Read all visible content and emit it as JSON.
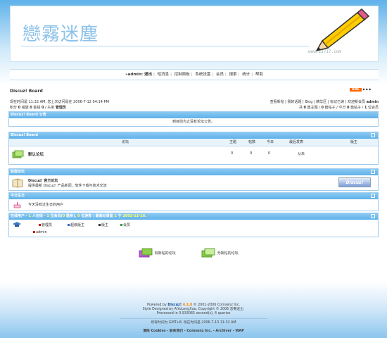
{
  "header": {
    "logo_text": "戀霧迷塵",
    "logo_url": "www.23717.com"
  },
  "menu": {
    "items": [
      "»admin: 退出",
      "短消息",
      "控制面板",
      "系统设置",
      "会员",
      "搜索",
      "统计",
      "帮助"
    ]
  },
  "breadcrumb": {
    "title": "Discuz! Board",
    "xml_label": "XML",
    "dots": "◆ ◆ ◆"
  },
  "info": {
    "left_line1": "现在时间是 11:32 AM, 您上次访问是在  2006-7-12 04:14 PM",
    "left_line2_prefix": "积分 ",
    "left_line2_a": "0",
    "left_line2_b": " 威望 ",
    "left_line2_c": "0",
    "left_line2_d": " 金钱 ",
    "left_line2_e": "0",
    "left_line2_f": " / 头衔 ",
    "left_line2_g": "管理员",
    "right_line1_a": "查看新帖 | 我的话题 | Blog | 精华区 | 标记已读 | 欢迎新会员 ",
    "right_line1_b": "admin",
    "right_line2_a": "共 ",
    "right_line2_b": "0",
    "right_line2_c": " 篇主题 / ",
    "right_line2_d": "0",
    "right_line2_e": " 篇帖子 / 今日 ",
    "right_line2_f": "0",
    "right_line2_g": " 篇帖子 / ",
    "right_line2_h": "1",
    "right_line2_i": " 位会员"
  },
  "announcement": {
    "title": "Discuz! Board 公告",
    "text": "到目前为止没有论坛公告。"
  },
  "forums": {
    "title": "Discuz! Board",
    "columns": [
      "论坛",
      "主题",
      "帖数",
      "今日",
      "最后发表",
      "版主"
    ],
    "rows": [
      {
        "name": "默认论坛",
        "topics": "0",
        "posts": "0",
        "today": "0",
        "last": "从未",
        "mod": ""
      }
    ]
  },
  "links": {
    "title": "联盟论坛",
    "name": "Discuz! 官方论坛",
    "desc": "提供最新 Discuz! 产品新闻、软件下载与技术交流",
    "button": "Discuz!"
  },
  "birthday": {
    "title": "今日生日",
    "text": "今天没有过生日的用户"
  },
  "online": {
    "title_a": "在线用户 - ",
    "title_b": "1",
    "title_c": " 人在线 - ",
    "title_d": "1",
    "title_e": " 位会员(",
    "title_f": "0",
    "title_g": " 隐身), ",
    "title_h": "0",
    "title_i": " 位游客 | 最高纪录是 ",
    "title_j": "1",
    "title_k": " 于 ",
    "title_l": "2002-12-16",
    "title_m": ".",
    "legend": [
      "管理员",
      "超级版主",
      "版主",
      "会员"
    ],
    "users": [
      "admin"
    ],
    "colors": {
      "admin": "#cc0000",
      "supermod": "#3366cc",
      "mod": "#333333",
      "member": "#339933"
    }
  },
  "legend_bottom": {
    "new": "有新帖的论坛",
    "none": "无新帖的论坛"
  },
  "footer": {
    "line1_a": "Powered by ",
    "line1_b": "Discuz!",
    "line1_c": " 4.1.0",
    "line1_d": "  © 2001-2006 Comsenz Inc.",
    "line2": "Style Designed by AiYuLengXue, Copyright © 2006 恋雾迷尘.",
    "line3": "Processed in 0.933065 second(s), 4 queries",
    "line4": "所有时间为 GMT+8, 现在时间是 2006-7-13 11:32 AM",
    "line5": "清除 Cookies - 联系我们 - Comsenz Inc. - Archiver - WAP"
  }
}
